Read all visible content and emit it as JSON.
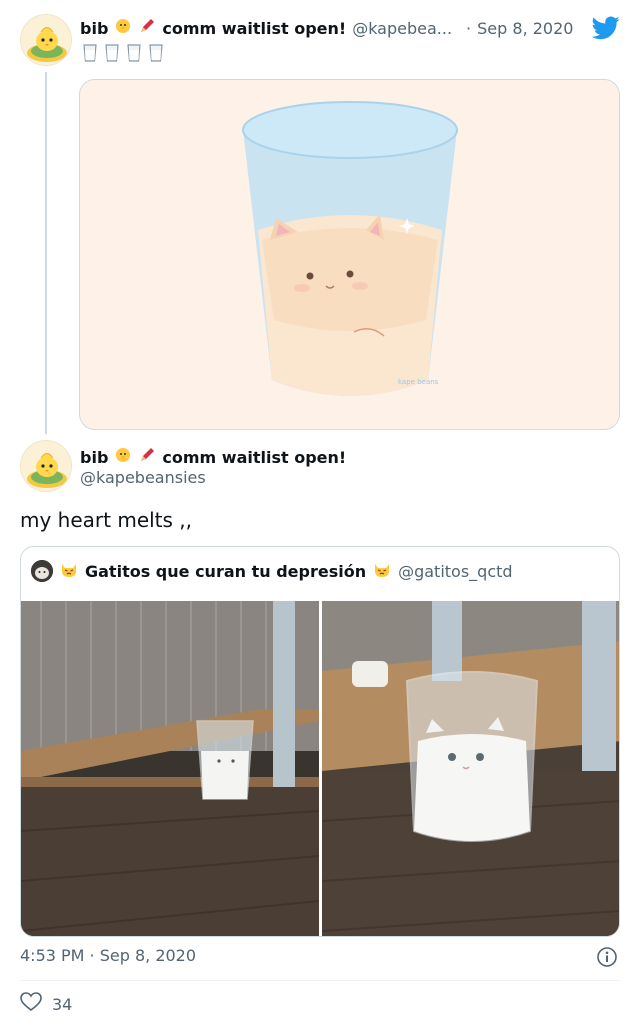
{
  "parent_tweet": {
    "display_name": "bib",
    "name_suffix": "comm waitlist open!",
    "handle": "@kapebea...",
    "separator": "·",
    "date": "Sep 8, 2020",
    "bio_icons": [
      "glass-icon",
      "glass-icon",
      "glass-icon",
      "glass-icon"
    ],
    "media_watermark": "kape beans",
    "icons": {
      "platform": "twitter-bird-icon",
      "chick": "chick-icon",
      "pencil": "pencil-icon"
    }
  },
  "main_tweet": {
    "display_name": "bib",
    "name_suffix": "comm waitlist open!",
    "handle": "@kapebeansies",
    "text": "my heart melts ,,",
    "timestamp": "4:53 PM · Sep 8, 2020",
    "like_count": "34"
  },
  "quoted_tweet": {
    "display_name": "Gatitos que curan tu depresión",
    "handle": "@gatitos_qctd",
    "icons": [
      "cat-face-icon",
      "cat-face-icon"
    ]
  },
  "colors": {
    "twitter_blue": "#1d9bf0",
    "text_primary": "#0f1419",
    "text_secondary": "#536471",
    "border": "#cfd9de",
    "pencil_red": "#d9303f",
    "chick_yellow": "#ffc83d"
  }
}
